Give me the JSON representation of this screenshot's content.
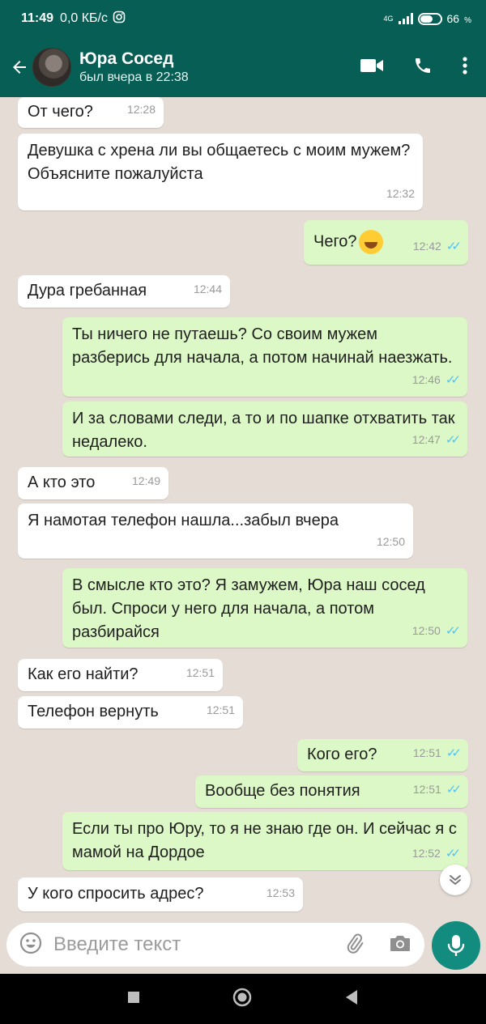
{
  "status_bar": {
    "time": "11:49",
    "network_speed": "0,0 КБ/с",
    "network_type": "4G",
    "battery": "66",
    "battery_unit": "%"
  },
  "header": {
    "contact_name": "Юра Сосед",
    "contact_status": "был вчера в 22:38"
  },
  "messages": [
    {
      "dir": "in",
      "text": "От чего?",
      "time": "12:28"
    },
    {
      "dir": "in",
      "text": "Девушка с хрена ли вы общаетесь с моим мужем? Объясните пожалуйста",
      "time": "12:32"
    },
    {
      "dir": "out",
      "text": "Чего?",
      "emoji": "grinning-squinting-face",
      "time": "12:42"
    },
    {
      "dir": "in",
      "text": "Дура гребанная",
      "time": "12:44"
    },
    {
      "dir": "out",
      "text": "Ты ничего не путаешь? Со своим мужем разберись для начала, а потом начинай наезжать.",
      "time": "12:46"
    },
    {
      "dir": "out",
      "text": "И за словами следи, а то и по шапке отхватить так недалеко.",
      "time": "12:47"
    },
    {
      "dir": "in",
      "text": "А кто это",
      "time": "12:49"
    },
    {
      "dir": "in",
      "text": "Я намотая телефон нашла...забыл вчера",
      "time": "12:50"
    },
    {
      "dir": "out",
      "text": "В смысле кто это? Я замужем, Юра наш сосед был. Спроси у него для начала, а потом разбирайся",
      "time": "12:50"
    },
    {
      "dir": "in",
      "text": "Как его найти?",
      "time": "12:51"
    },
    {
      "dir": "in",
      "text": "Телефон вернуть",
      "time": "12:51"
    },
    {
      "dir": "out",
      "text": "Кого его?",
      "time": "12:51"
    },
    {
      "dir": "out",
      "text": "Вообще без понятия",
      "time": "12:51"
    },
    {
      "dir": "out",
      "text": "Если ты про Юру, то я не знаю где он. И сейчас я с мамой на Дордое",
      "time": "12:52"
    },
    {
      "dir": "in",
      "text": "У кого спросить адрес?",
      "time": "12:53"
    }
  ],
  "composer": {
    "placeholder": "Введите текст"
  },
  "icons": {
    "back": "arrow-back-icon",
    "video": "video-call-icon",
    "call": "phone-icon",
    "menu": "more-vert-icon",
    "emoji": "emoji-icon",
    "attach": "paperclip-icon",
    "camera": "camera-icon",
    "mic": "microphone-icon",
    "scroll": "double-chevron-down-icon"
  },
  "colors": {
    "header": "#075e54",
    "incoming_bubble": "#ffffff",
    "outgoing_bubble": "#dcf8c6",
    "read_ticks": "#4fc3f7",
    "mic_button": "#128c7e",
    "chat_background": "#e5ddd5"
  }
}
